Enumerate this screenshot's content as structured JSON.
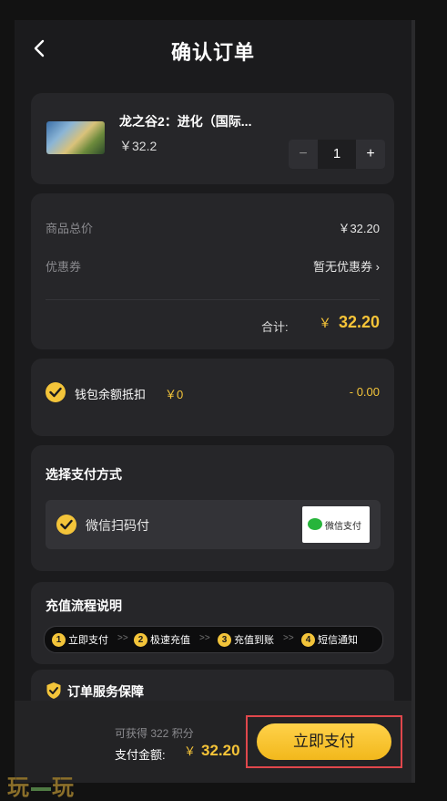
{
  "header": {
    "title": "确认订单"
  },
  "product": {
    "name": "龙之谷2：进化（国际...",
    "price": "￥32.2",
    "quantity": "1",
    "minus": "−",
    "plus": "+"
  },
  "price": {
    "subtotal_label": "商品总价",
    "subtotal_value": "￥32.20",
    "coupon_label": "优惠券",
    "coupon_value": "暂无优惠券 ›",
    "total_label": "合计:",
    "total_currency": "￥",
    "total_value": "32.20"
  },
  "wallet": {
    "label": "钱包余额抵扣",
    "amount": "￥0",
    "deduct": "- 0.00"
  },
  "payment": {
    "title": "选择支付方式",
    "option_label": "微信扫码付",
    "logo_text": "微信支付"
  },
  "process": {
    "title": "充值流程说明",
    "steps": [
      {
        "num": "1",
        "label": "立即支付"
      },
      {
        "num": "2",
        "label": "极速充值"
      },
      {
        "num": "3",
        "label": "充值到账"
      },
      {
        "num": "4",
        "label": "短信通知"
      }
    ],
    "arrow": ">>"
  },
  "guarantee": {
    "title": "订单服务保障"
  },
  "footer": {
    "points": "可获得 322 积分",
    "pay_label": "支付金额:",
    "pay_currency": "￥",
    "pay_value": "32.20",
    "pay_button": "立即支付"
  },
  "watermark": {
    "left": "玩",
    "right": "玩"
  },
  "colors": {
    "accent": "#f6c438",
    "highlight_border": "#e0474c",
    "wechat_green": "#27b53b"
  },
  "icons": {
    "back": "back-arrow-icon",
    "check": "check-circle-icon",
    "shield": "shield-check-icon",
    "wechat": "wechat-pay-logo"
  }
}
